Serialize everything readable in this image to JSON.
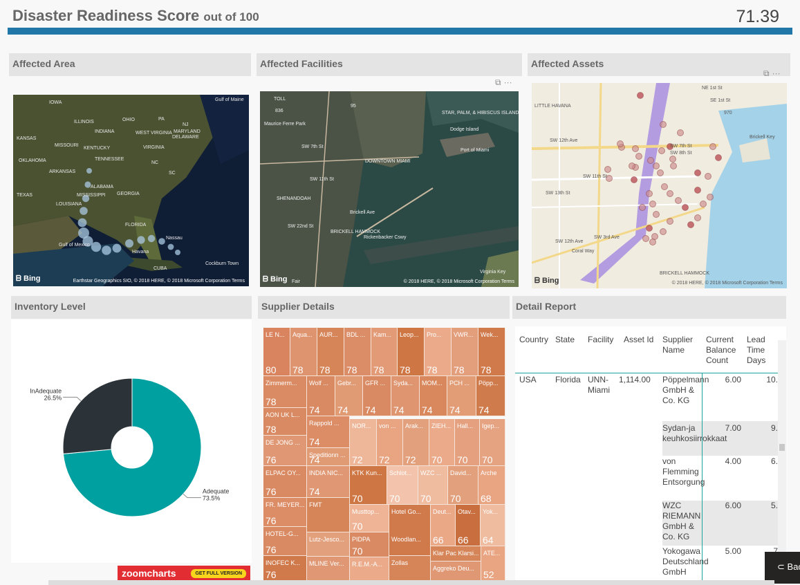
{
  "header": {
    "title": "Disaster Readiness Score",
    "title_suffix": "out of 100",
    "score": "71.39",
    "accent_color": "#2178a8"
  },
  "panels": {
    "affected_area": {
      "title": "Affected Area",
      "labels": [
        "IOWA",
        "ILLINOIS",
        "INDIANA",
        "OHIO",
        "PA",
        "NJ",
        "KANSAS",
        "MISSOURI",
        "KENTUCKY",
        "WEST VIRGINIA",
        "VIRGINIA",
        "MARYLAND",
        "DELAWARE",
        "OKLAHOMA",
        "TENNESSEE",
        "NC",
        "ARKANSAS",
        "SC",
        "ALABAMA",
        "GEORGIA",
        "TEXAS",
        "MISSISSIPPI",
        "LOUISIANA",
        "FLORIDA",
        "Gulf of Maine",
        "Gulf of Mexico",
        "Nassau",
        "Havana",
        "CUBA",
        "Cockburn Town"
      ],
      "bing_label": "Bing",
      "attribution": "Earthstar Geographics SIO, © 2018 HERE, © 2018 Microsoft Corporation  Terms"
    },
    "affected_facilities": {
      "title": "Affected Facilities",
      "labels": [
        "TOLL",
        "836",
        "95",
        "Dodge Island",
        "Port of Miami",
        "STAR, PALM, & HIBISCUS ISLANDS",
        "Maurice Ferre Park",
        "DOWNTOWN MIAMI",
        "SW 7th St",
        "SW 11th St",
        "SHENANDOAH",
        "SW 22nd St",
        "BRICKELL HAMMOCK",
        "Rickenbacker Cswy",
        "Brickell Ave",
        "Virginia Key",
        "Fair"
      ],
      "bing_label": "Bing",
      "attribution": "© 2018 HERE, © 2018 Microsoft Corporation  Terms"
    },
    "affected_assets": {
      "title": "Affected Assets",
      "labels": [
        "LITTLE HAVANA",
        "SW 12th Ave",
        "SW 7th St",
        "SW 8th St",
        "SW 11th St",
        "SW 13th St",
        "Coral Way",
        "SW 3rd Ave",
        "Brickell Key",
        "SE 1st St",
        "NE 1st St",
        "970",
        "BRICKELL HAMMOCK",
        "SW 12th Ave"
      ],
      "bing_label": "Bing",
      "attribution": "© 2018 HERE, © 2018 Microsoft Corporation  Terms"
    },
    "inventory_level": {
      "title": "Inventory Level"
    },
    "supplier_details": {
      "title": "Supplier Details"
    },
    "detail_report": {
      "title": "Detail Report"
    }
  },
  "chart_data": {
    "type": "pie",
    "style": "donut",
    "categories": [
      "Adequate",
      "InAdequate"
    ],
    "values": [
      73.5,
      26.5
    ],
    "labels": [
      "Adequate\n73.5%",
      "InAdequate\n26.5%"
    ],
    "colors": [
      "#009fa0",
      "#2b3338"
    ]
  },
  "treemap": [
    {
      "name": "LE N...",
      "value": "80",
      "color": "#d9845e"
    },
    {
      "name": "Aqua...",
      "value": "78",
      "color": "#de946f"
    },
    {
      "name": "AUR...",
      "value": "78",
      "color": "#d68558"
    },
    {
      "name": "BDL ...",
      "value": "78",
      "color": "#db8d67"
    },
    {
      "name": "Kam...",
      "value": "78",
      "color": "#e39a77"
    },
    {
      "name": "Leop...",
      "value": "78",
      "color": "#cf7744"
    },
    {
      "name": "Pro...",
      "value": "78",
      "color": "#ebab8b"
    },
    {
      "name": "VWR...",
      "value": "78",
      "color": "#e39e7c"
    },
    {
      "name": "Wek...",
      "value": "78",
      "color": "#d07a4b"
    },
    {
      "name": "Zimmerm...",
      "value": "78",
      "color": "#db8b63"
    },
    {
      "name": "Wolf ...",
      "value": "74",
      "color": "#d98a62"
    },
    {
      "name": "Gebr...",
      "value": "74",
      "color": "#e09a74"
    },
    {
      "name": "GFR ...",
      "value": "74",
      "color": "#d98a62"
    },
    {
      "name": "Syda...",
      "value": "74",
      "color": "#de9570"
    },
    {
      "name": "MOM...",
      "value": "74",
      "color": "#d9875c"
    },
    {
      "name": "PCH ...",
      "value": "74",
      "color": "#e29c76"
    },
    {
      "name": "Pöpp...",
      "value": "74",
      "color": "#d07b4c"
    },
    {
      "name": "AON UK L...",
      "value": "78",
      "color": "#d98a62"
    },
    {
      "name": "DE JONG ...",
      "value": "76",
      "color": "#e09874"
    },
    {
      "name": "Rappold ...",
      "value": "74",
      "color": "#dc8d66"
    },
    {
      "name": "Speditionn ...",
      "value": "74",
      "color": "#e09a74"
    },
    {
      "name": "NOR...",
      "value": "72",
      "color": "#efb79a"
    },
    {
      "name": "von ...",
      "value": "72",
      "color": "#e9a482"
    },
    {
      "name": "Arak...",
      "value": "72",
      "color": "#e3a07d"
    },
    {
      "name": "ZIEH...",
      "value": "70",
      "color": "#ebab8b"
    },
    {
      "name": "Hall...",
      "value": "70",
      "color": "#e5a17f"
    },
    {
      "name": "Igep...",
      "value": "70",
      "color": "#e6a381"
    },
    {
      "name": "ELPAC OY...",
      "value": "76",
      "color": "#d98a62"
    },
    {
      "name": "INDIA NIC...",
      "value": "74",
      "color": "#e09874"
    },
    {
      "name": "KTK Kun...",
      "value": "70",
      "color": "#cf7744"
    },
    {
      "name": "Schlot...",
      "value": "70",
      "color": "#f3c4ab"
    },
    {
      "name": "WZC ...",
      "value": "70",
      "color": "#f0bca0"
    },
    {
      "name": "David...",
      "value": "70",
      "color": "#e3a07d"
    },
    {
      "name": "Arche",
      "value": "68",
      "color": "#e9a482"
    },
    {
      "name": "FR. MEYER...",
      "value": "76",
      "color": "#dc8d66"
    },
    {
      "name": "FMT",
      "value": "",
      "color": "#d68558"
    },
    {
      "name": "Musttop...",
      "value": "70",
      "color": "#efb496"
    },
    {
      "name": "Hotel Go...",
      "value": "",
      "color": "#d07a4b"
    },
    {
      "name": "Deut...",
      "value": "66",
      "color": "#eaa887"
    },
    {
      "name": "Otav...",
      "value": "66",
      "color": "#c86e3f"
    },
    {
      "name": "Yok...",
      "value": "64",
      "color": "#f0bca0"
    },
    {
      "name": "HOTEL-G...",
      "value": "76",
      "color": "#d98a62"
    },
    {
      "name": "Lutz-Jesco...",
      "value": "",
      "color": "#e3a07d"
    },
    {
      "name": "PIDPA",
      "value": "70",
      "color": "#d98a62"
    },
    {
      "name": "Woodlan...",
      "value": "",
      "color": "#d07a4b"
    },
    {
      "name": "Klar Pac Klarsi...",
      "value": "",
      "color": "#d68558"
    },
    {
      "name": "ATE...",
      "value": "52",
      "color": "#e9a482"
    },
    {
      "name": "INOFEC K...",
      "value": "76",
      "color": "#d07a4b"
    },
    {
      "name": "MLINE Ver...",
      "value": "",
      "color": "#e09874"
    },
    {
      "name": "R.E.M.-A...",
      "value": "",
      "color": "#ebab8b"
    },
    {
      "name": "Zollas",
      "value": "",
      "color": "#d68558"
    },
    {
      "name": "Aggreko Deu...",
      "value": "",
      "color": "#e09874"
    }
  ],
  "report": {
    "columns": [
      "Country",
      "State",
      "Facility",
      "Asset Id",
      "Supplier Name",
      "Current Balance Count",
      "Lead Time Days"
    ],
    "rows": [
      {
        "country": "USA",
        "state": "Florida",
        "facility": "UNN-Miami",
        "asset": "1,114.00",
        "supplier": "Pöppelmann GmbH & Co. KG",
        "balance": "6.00",
        "lead": "10."
      },
      {
        "country": "",
        "state": "",
        "facility": "",
        "asset": "",
        "supplier": "Sydan-ja keuhkosiirrokkaat",
        "balance": "7.00",
        "lead": "9."
      },
      {
        "country": "",
        "state": "",
        "facility": "",
        "asset": "",
        "supplier": "von Flemming Entsorgung",
        "balance": "4.00",
        "lead": "6."
      },
      {
        "country": "",
        "state": "",
        "facility": "",
        "asset": "",
        "supplier": "WZC RIEMANN GmbH & Co. KG",
        "balance": "6.00",
        "lead": "5."
      },
      {
        "country": "",
        "state": "",
        "facility": "",
        "asset": "",
        "supplier": "Yokogawa Deutschland GmbH",
        "balance": "5.00",
        "lead": "7"
      }
    ]
  },
  "zoomcharts": {
    "logo": "zoomcharts",
    "cta": "GET FULL VERSION"
  },
  "back_button": {
    "label": "Bac"
  }
}
